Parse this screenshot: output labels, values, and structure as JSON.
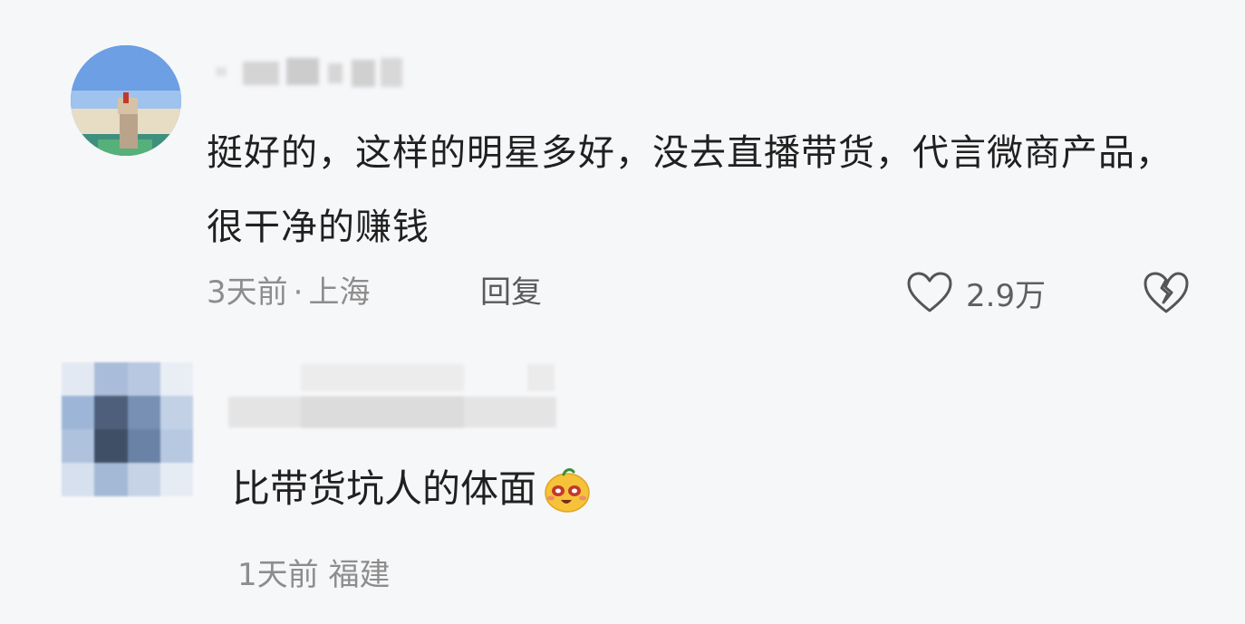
{
  "comments": [
    {
      "text": "挺好的，这样的明星多好，没去直播带货，代言微商产品，很干净的赚钱",
      "time": "3天前",
      "separator": "·",
      "location": "上海",
      "reply_label": "回复",
      "like_count": "2.9万",
      "icons": {
        "like": "heart-outline-icon",
        "dislike": "broken-heart-icon"
      }
    },
    {
      "text": "比带货坑人的体面",
      "emoji": "laughing-emoji",
      "time": "1天前",
      "location": "福建"
    }
  ],
  "colors": {
    "background": "#f6f7f9",
    "text": "#202020",
    "meta": "#8d8d8d"
  }
}
